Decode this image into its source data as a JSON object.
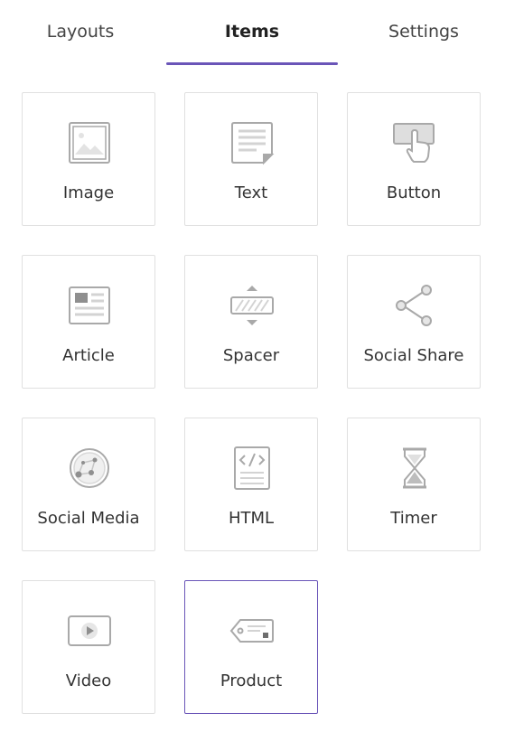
{
  "tabs": [
    {
      "label": "Layouts",
      "active": false
    },
    {
      "label": "Items",
      "active": true
    },
    {
      "label": "Settings",
      "active": false
    }
  ],
  "accent_color": "#6a55b8",
  "icon_color": "#a9a9a9",
  "items": [
    {
      "label": "Image",
      "icon": "image-icon"
    },
    {
      "label": "Text",
      "icon": "text-document-icon"
    },
    {
      "label": "Button",
      "icon": "button-click-icon"
    },
    {
      "label": "Article",
      "icon": "article-icon"
    },
    {
      "label": "Spacer",
      "icon": "spacer-icon"
    },
    {
      "label": "Social Share",
      "icon": "share-icon"
    },
    {
      "label": "Social Media",
      "icon": "social-network-icon"
    },
    {
      "label": "HTML",
      "icon": "html-code-icon"
    },
    {
      "label": "Timer",
      "icon": "hourglass-icon"
    },
    {
      "label": "Video",
      "icon": "video-play-icon"
    },
    {
      "label": "Product",
      "icon": "product-tag-icon",
      "selected": true
    }
  ]
}
